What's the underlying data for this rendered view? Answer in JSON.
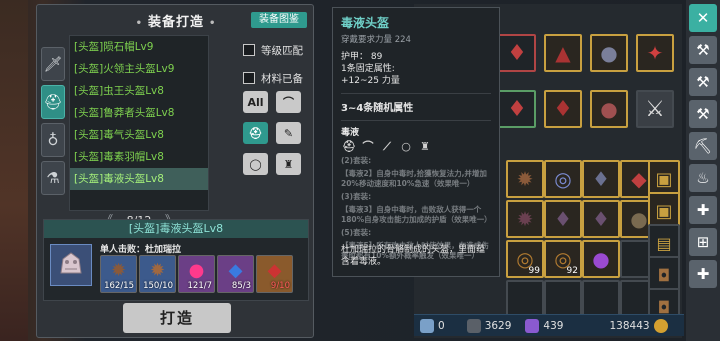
{
  "craft": {
    "title": "装备打造",
    "atlas_button": "装备图鉴",
    "items": [
      "[头盔]陨石帽Lv9",
      "[头盔]火领主头盔Lv9",
      "[头盔]虫王头盔Lv8",
      "[头盔]鲁莽者头盔Lv8",
      "[头盔]毒气头盔Lv8",
      "[头盔]毒素羽帽Lv8",
      "[头盔]毒液头盔Lv8"
    ],
    "page": "8/12",
    "check_level": "等级匹配",
    "check_materials": "材料已备",
    "filter_all": "All",
    "selected_title": "[头盔]毒液头盔Lv8",
    "materials_title": "单人击败：杜加瑞拉",
    "materials": [
      {
        "count": "162/15",
        "color": "#8a5a3a"
      },
      {
        "count": "150/10",
        "color": "#8a5a3a"
      },
      {
        "count": "121/7",
        "color": "#c0306a"
      },
      {
        "count": "85/3",
        "color": "#2a5aa0"
      },
      {
        "count": "9/10",
        "color": "#a03030"
      }
    ],
    "craft_button": "打造"
  },
  "tooltip": {
    "name": "毒液头盔",
    "requirement": "穿戴要求力量 224",
    "armor_label": "护甲：",
    "armor_value": "89",
    "fixed_attr": "1条固定属性:",
    "fixed_value": "+12~25 力量",
    "random_attr": "3~4条随机属性",
    "set_name": "毒液",
    "set_lines": [
      "(2)套装:",
      "【毒液2】自身中毒时,拾獲恢复法力,并增加20%移动速度和10%急速（效果唯一）",
      "(3)套装:",
      "【毒液3】自身中毒时，击败敌人获得一个180%自身攻击能力加成的护盾（效果唯一）",
      "(5)套装:",
      "【毒液5】所有攻击敌人时使效果，在造成伤害时都有10%额外概率触发（效果唯一）"
    ],
    "description": "杜加瑞拉的骨骼制成的头盔，里面蕴含着毒液。"
  },
  "inventory": {
    "stack_counts": [
      "99",
      "92"
    ]
  },
  "currency": {
    "c1": "0",
    "c2": "3629",
    "c3": "439",
    "c4": "138443"
  },
  "colors": {
    "accent": "#2f9a8e",
    "item_green": "#7ed14f",
    "tooltip_name": "#6fd0c8"
  }
}
